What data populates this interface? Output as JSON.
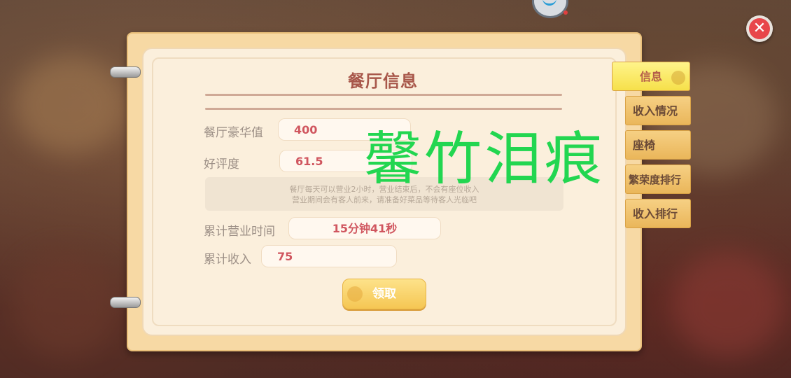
{
  "panel": {
    "title": "餐厅信息",
    "fields": [
      {
        "label": "餐厅豪华值",
        "value": "400"
      },
      {
        "label": "好评度",
        "value": "61.5"
      }
    ],
    "notice_lines": [
      "餐厅每天可以营业2小时，营业结束后，不会有座位收入",
      "营业期间会有客人前来，请准备好菜品等待客人光临吧"
    ],
    "stats": [
      {
        "label": "累计营业时间",
        "value": "15分钟41秒"
      },
      {
        "label": "累计收入",
        "value": "75"
      }
    ],
    "claim_label": "领取"
  },
  "tabs": [
    {
      "label": "信息",
      "active": true
    },
    {
      "label": "收入情况",
      "active": false
    },
    {
      "label": "座椅",
      "active": false
    },
    {
      "label": "繁荣度排行",
      "active": false
    },
    {
      "label": "收入排行",
      "active": false
    }
  ],
  "watermark": "馨竹泪痕",
  "icons": {
    "close": "close-icon",
    "top": "avatar-widget-icon"
  },
  "colors": {
    "accent": "#d0565f",
    "title": "#a8574a",
    "tab_active": "#f6e04a",
    "watermark": "#22d650"
  }
}
